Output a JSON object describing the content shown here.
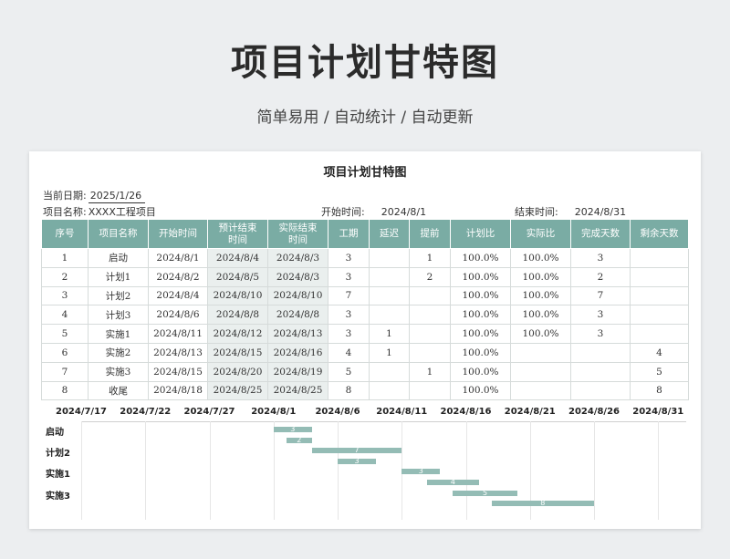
{
  "hero": {
    "title": "项目计划甘特图",
    "subtitle": "简单易用  /  自动统计  /  自动更新"
  },
  "sheet": {
    "title": "项目计划甘特图",
    "current_date_label": "当前日期:",
    "current_date": "2025/1/26",
    "project_name_label": "项目名称:",
    "project_name": "XXXX工程项目",
    "start_label": "开始时间:",
    "start_value": "2024/8/1",
    "end_label": "结束时间:",
    "end_value": "2024/8/31"
  },
  "table": {
    "headers": [
      "序号",
      "项目名称",
      "开始时间",
      "预计结束\n时间",
      "实际结束\n时间",
      "工期",
      "延迟",
      "提前",
      "计划比",
      "实际比",
      "完成天数",
      "剩余天数"
    ],
    "rows": [
      [
        "1",
        "启动",
        "2024/8/1",
        "2024/8/4",
        "2024/8/3",
        "3",
        "",
        "1",
        "100.0%",
        "100.0%",
        "3",
        ""
      ],
      [
        "2",
        "计划1",
        "2024/8/2",
        "2024/8/5",
        "2024/8/3",
        "3",
        "",
        "2",
        "100.0%",
        "100.0%",
        "2",
        ""
      ],
      [
        "3",
        "计划2",
        "2024/8/4",
        "2024/8/10",
        "2024/8/10",
        "7",
        "",
        "",
        "100.0%",
        "100.0%",
        "7",
        ""
      ],
      [
        "4",
        "计划3",
        "2024/8/6",
        "2024/8/8",
        "2024/8/8",
        "3",
        "",
        "",
        "100.0%",
        "100.0%",
        "3",
        ""
      ],
      [
        "5",
        "实施1",
        "2024/8/11",
        "2024/8/12",
        "2024/8/13",
        "3",
        "1",
        "",
        "100.0%",
        "100.0%",
        "3",
        ""
      ],
      [
        "6",
        "实施2",
        "2024/8/13",
        "2024/8/15",
        "2024/8/16",
        "4",
        "1",
        "",
        "100.0%",
        "",
        "",
        "4"
      ],
      [
        "7",
        "实施3",
        "2024/8/15",
        "2024/8/20",
        "2024/8/19",
        "5",
        "",
        "1",
        "100.0%",
        "",
        "",
        "5"
      ],
      [
        "8",
        "收尾",
        "2024/8/18",
        "2024/8/25",
        "2024/8/25",
        "8",
        "",
        "",
        "100.0%",
        "",
        "",
        "8"
      ]
    ]
  },
  "gantt": {
    "x_ticks": [
      "2024/7/17",
      "2024/7/22",
      "2024/7/27",
      "2024/8/1",
      "2024/8/6",
      "2024/8/11",
      "2024/8/16",
      "2024/8/21",
      "2024/8/26",
      "2024/8/31"
    ],
    "y_labels": [
      "启动",
      "计划2",
      "实施1",
      "实施3"
    ],
    "bar_color": "#94bcb5",
    "bars": [
      {
        "task": "启动",
        "start_day": 15,
        "duration": 3,
        "label": "3"
      },
      {
        "task": "计划1",
        "start_day": 16,
        "duration": 2,
        "label": "2"
      },
      {
        "task": "计划2",
        "start_day": 18,
        "duration": 7,
        "label": "7"
      },
      {
        "task": "计划3",
        "start_day": 20,
        "duration": 3,
        "label": "3"
      },
      {
        "task": "实施1",
        "start_day": 25,
        "duration": 3,
        "label": "3"
      },
      {
        "task": "实施2",
        "start_day": 27,
        "duration": 4,
        "label": "4"
      },
      {
        "task": "实施3",
        "start_day": 29,
        "duration": 5,
        "label": "5"
      },
      {
        "task": "收尾",
        "start_day": 32,
        "duration": 8,
        "label": "8"
      }
    ]
  },
  "colors": {
    "header_bg": "#7aaca4",
    "shade_col": "#eaefee"
  }
}
